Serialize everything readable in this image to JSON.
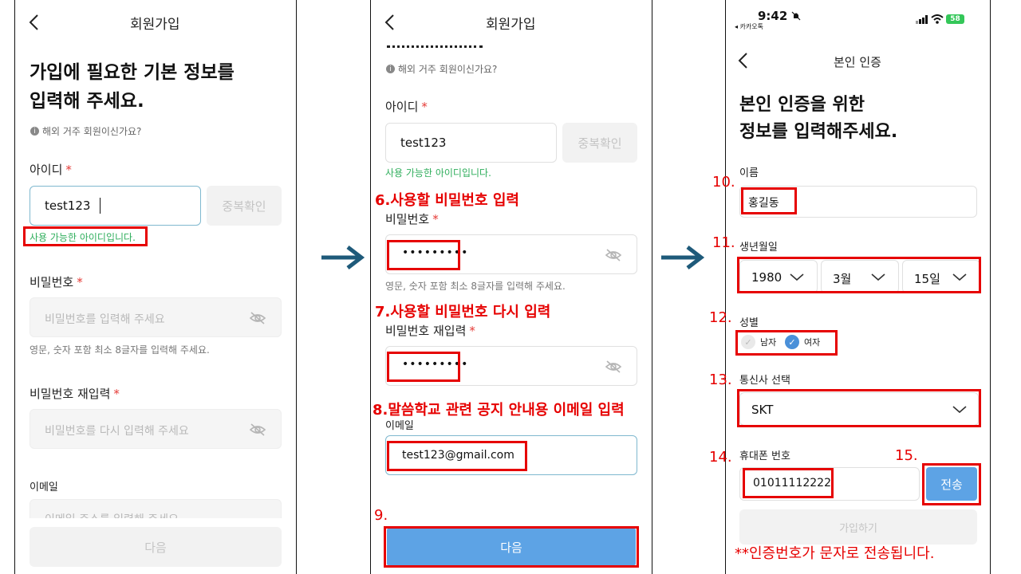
{
  "colors": {
    "accent": "#5da3e5",
    "success": "#2fae5c",
    "annotation": "#e60000"
  },
  "screen1": {
    "header_title": "회원가입",
    "heading_line1": "가입에 필요한 기본 정보를",
    "heading_line2": "입력해 주세요.",
    "overseas_link": "해외 거주 회원이신가요?",
    "id_label": "아이디",
    "required_mark": "*",
    "id_value": "test123",
    "dup_check_button": "중복확인",
    "id_ok_message": "사용 가능한 아이디입니다.",
    "password_label": "비밀번호",
    "password_placeholder": "비밀번호를 입력해 주세요",
    "password_hint": "영문, 숫자 포함 최소 8글자를 입력해 주세요.",
    "password_confirm_label": "비밀번호 재입력",
    "password_confirm_placeholder": "비밀번호를 다시 입력해 주세요",
    "email_label": "이메일",
    "email_placeholder": "이메일 주소를 입력해 주세요",
    "next_button": "다음"
  },
  "screen2": {
    "header_title": "회원가입",
    "overseas_link": "해외 거주 회원이신가요?",
    "id_label": "아이디",
    "required_mark": "*",
    "id_value": "test123",
    "dup_check_button": "중복확인",
    "id_ok_message": "사용 가능한 아이디입니다.",
    "password_label": "비밀번호",
    "password_value": "•••••••••",
    "password_hint": "영문, 숫자 포함 최소 8글자를 입력해 주세요.",
    "password_confirm_label": "비밀번호 재입력",
    "password_confirm_value": "•••••••••",
    "email_label": "이메일",
    "email_value": "test123@gmail.com",
    "next_button": "다음"
  },
  "screen3": {
    "status_time": "9:42",
    "status_back_app": "◂ 카카오톡",
    "battery": "58",
    "header_title": "본인 인증",
    "heading_line1": "본인 인증을 위한",
    "heading_line2": "정보를 입력해주세요.",
    "name_label": "이름",
    "name_value": "홍길동",
    "birth_label": "생년월일",
    "birth_year": "1980",
    "birth_month": "3월",
    "birth_day": "15일",
    "gender_label": "성별",
    "gender_male": "남자",
    "gender_female": "여자",
    "carrier_label": "통신사 선택",
    "carrier_value": "SKT",
    "phone_label": "휴대폰 번호",
    "phone_value": "01011112222",
    "send_button": "전송",
    "join_button": "가입하기"
  },
  "annotations": {
    "a6": "6.사용할 비밀번호 입력",
    "a7": "7.사용할 비밀번호 다시 입력",
    "a8": "8.말씀학교 관련 공지 안내용 이메일 입력",
    "a9": "9.",
    "a10": "10.",
    "a11": "11.",
    "a12": "12.",
    "a13": "13.",
    "a14": "14.",
    "a15": "15.",
    "note": "**인증번호가 문자로 전송됩니다."
  }
}
